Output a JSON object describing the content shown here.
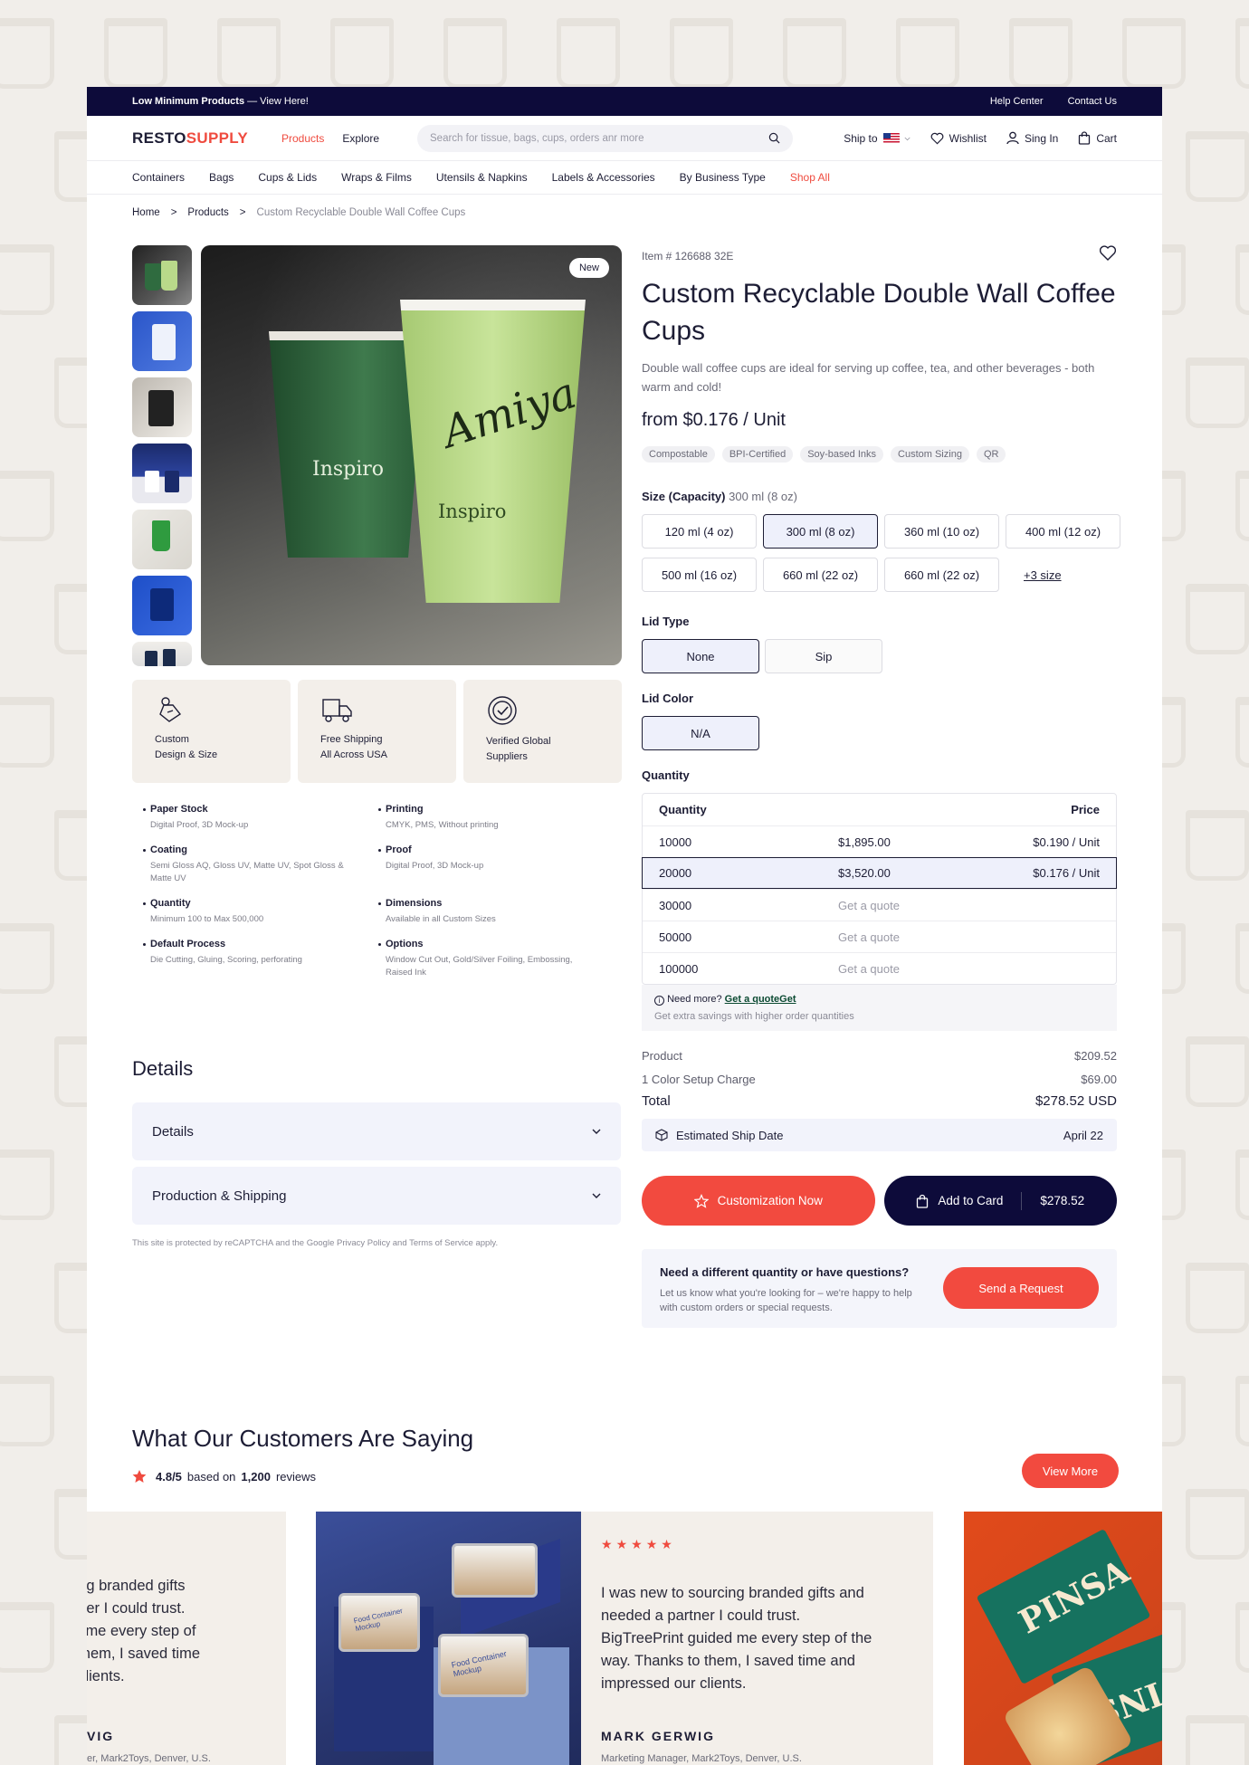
{
  "topbar": {
    "promo_bold": "Low Minimum Products",
    "promo_rest": " — View Here!",
    "help": "Help Center",
    "contact": "Contact Us"
  },
  "header": {
    "logo_a": "RESTO",
    "logo_b": "SUPPLY",
    "nav": [
      "Products",
      "Explore"
    ],
    "search_placeholder": "Search for tissue, bags, cups, orders anr more",
    "ship_to": "Ship to",
    "wishlist": "Wishlist",
    "signin": "Sing In",
    "cart": "Cart"
  },
  "categories": [
    "Containers",
    "Bags",
    "Cups & Lids",
    "Wraps & Films",
    "Utensils & Napkins",
    "Labels & Accessories",
    "By Business Type",
    "Shop All"
  ],
  "breadcrumb": [
    "Home",
    "Products",
    "Custom Recyclable Double Wall Coffee Cups"
  ],
  "breadcrumb_sep": ">",
  "gallery": {
    "badge": "New",
    "cup_brand": "Inspiro",
    "cup_script": "Amiya"
  },
  "features": [
    "Custom Design & Size",
    "Free Shipping All Across USA",
    "Verified Global Suppliers"
  ],
  "features_lines": [
    [
      "Custom",
      "Design & Size"
    ],
    [
      "Free Shipping",
      "All Across USA"
    ],
    [
      "Verified Global",
      "Suppliers"
    ]
  ],
  "specs": [
    {
      "title": "Paper Stock",
      "desc": "Digital Proof, 3D Mock-up"
    },
    {
      "title": "Printing",
      "desc": "CMYK, PMS, Without printing"
    },
    {
      "title": "Coating",
      "desc": "Semi Gloss AQ, Gloss UV, Matte UV, Spot Gloss & Matte UV"
    },
    {
      "title": "Proof",
      "desc": "Digital Proof, 3D Mock-up"
    },
    {
      "title": "Quantity",
      "desc": "Minimum 100 to Max 500,000"
    },
    {
      "title": "Dimensions",
      "desc": "Available in all Custom Sizes"
    },
    {
      "title": "Default Process",
      "desc": "Die Cutting, Gluing, Scoring, perforating"
    },
    {
      "title": "Options",
      "desc": "Window Cut Out, Gold/Silver Foiling, Embossing, Raised Ink"
    }
  ],
  "details": {
    "heading": "Details",
    "accordions": [
      "Details",
      "Production & Shipping"
    ],
    "recaptcha": "This site is protected by reCAPTCHA and the Google Privacy Policy and Terms of Service apply."
  },
  "product": {
    "item_no": "Item # 126688 32E",
    "title": "Custom Recyclable Double Wall Coffee Cups",
    "description": "Double wall coffee cups are ideal for serving up coffee, tea, and other beverages - both warm and cold!",
    "price": "from $0.176 / Unit",
    "tags": [
      "Compostable",
      "BPI-Certified",
      "Soy-based Inks",
      "Custom Sizing",
      "QR"
    ]
  },
  "size": {
    "label": "Size (Capacity)",
    "selected": "300 ml (8 oz)",
    "options": [
      "120 ml (4 oz)",
      "300 ml (8 oz)",
      "360 ml (10 oz)",
      "400 ml (12 oz)",
      "500 ml (16 oz)",
      "660 ml (22 oz)",
      "660 ml (22 oz)"
    ],
    "more": "+3 size"
  },
  "lid_type": {
    "label": "Lid Type",
    "options": [
      "None",
      "Sip"
    ],
    "selected": "None"
  },
  "lid_color": {
    "label": "Lid Color",
    "options": [
      "N/A"
    ],
    "selected": "N/A"
  },
  "quantity": {
    "label": "Quantity",
    "headers": [
      "Quantity",
      "Price"
    ],
    "rows": [
      {
        "qty": "10000",
        "total": "$1,895.00",
        "unit": "$0.190 / Unit"
      },
      {
        "qty": "20000",
        "total": "$3,520.00",
        "unit": "$0.176 / Unit"
      },
      {
        "qty": "30000",
        "total": "Get a quote",
        "unit": ""
      },
      {
        "qty": "50000",
        "total": "Get a quote",
        "unit": ""
      },
      {
        "qty": "100000",
        "total": "Get a quote",
        "unit": ""
      }
    ],
    "selected": "20000",
    "need_more": "Need more?",
    "quote_link": "Get a quoteGet",
    "savings": "Get extra savings with higher order quantities"
  },
  "summary": {
    "product_label": "Product",
    "product_value": "$209.52",
    "setup_label": "1 Color Setup Charge",
    "setup_value": "$69.00",
    "total_label": "Total",
    "total_value": "$278.52 USD",
    "ship_label": "Estimated Ship Date",
    "ship_value": "April 22"
  },
  "actions": {
    "customize": "Customization Now",
    "add_to_cart": "Add to Card",
    "cart_total": "$278.52"
  },
  "request": {
    "title": "Need a different quantity or have questions?",
    "desc": "Let us know what you're looking for – we're happy to help with custom orders or special requests.",
    "button": "Send a Request"
  },
  "reviews": {
    "heading": "What Our Customers Are Saying",
    "rating": "4.8/5",
    "based_on": "based on",
    "count": "1,200",
    "reviews_word": "reviews",
    "view_more": "View More",
    "stars": 5,
    "left_partial_lines": [
      "ng branded gifts",
      "ner I could trust.",
      "l me every step of",
      "them, I saved time",
      "clients."
    ],
    "left_name": "VIG",
    "left_role": "er, Mark2Toys, Denver, U.S.",
    "quote": "I was new to sourcing branded gifts and needed a partner I could trust. BigTreePrint guided me every step of the way. Thanks to them, I saved time and impressed our clients.",
    "name": "MARK GERWIG",
    "role": "Marketing Manager, Mark2Toys, Denver, U.S.",
    "mockup_label": "Food Container Mockup",
    "pizza_label": "PINSA"
  },
  "colors": {
    "accent": "#f24a3f",
    "navy": "#0d0b3a",
    "green_cup": "#2f6b3f",
    "lime_cup": "#b9d98a"
  }
}
